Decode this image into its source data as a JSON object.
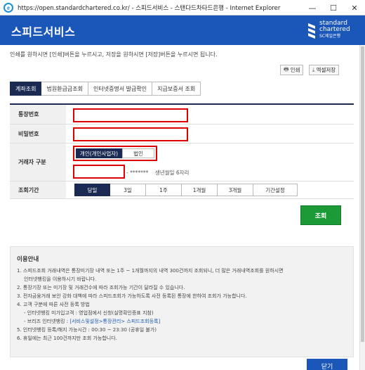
{
  "window": {
    "title": "https://open.standardchartered.co.kr/ - 스피드서비스 - 스탠다드차타드은행 - Internet Explorer",
    "icon": "ie-icon",
    "controls": [
      "—",
      "☐",
      "✕"
    ]
  },
  "header": {
    "title": "스피드서비스",
    "logo": {
      "line1": "standard",
      "line2": "chartered",
      "line3": "SC제일은행"
    }
  },
  "intro_text": "인쇄를 원하시면 [인쇄]버튼을 누르시고, 저장을 원하시면 [저장]버튼을 누르시면 됩니다.",
  "toolbar": {
    "print_label": "인쇄",
    "excel_label": "엑셀저장"
  },
  "tabs": [
    {
      "label": "계좌조회",
      "active": true
    },
    {
      "label": "법원환급금조회",
      "active": false
    },
    {
      "label": "인터넷증명서 발급확인",
      "active": false
    },
    {
      "label": "지급보증서 조회",
      "active": false
    }
  ],
  "form": {
    "account_label": "통장번호",
    "account_value": "",
    "password_label": "비밀번호",
    "password_value": "",
    "customer_type_label": "거래자 구분",
    "customer_types": [
      "개인(개인사업자)",
      "법인"
    ],
    "customer_type_selected": "개인(개인사업자)",
    "birth_value": "",
    "birth_mask": "- *******",
    "birth_hint": "생년월일 6자리",
    "period_label": "조회기간",
    "periods": [
      "당일",
      "3일",
      "1주",
      "1개월",
      "3개월",
      "기간설정"
    ],
    "period_selected": "당일",
    "search_label": "조회"
  },
  "notice": {
    "title": "이용안내",
    "items": [
      "1. 스피드조회 거래내역은 통장미기장 내역 또는 1주 ~ 1개월까지의 내역 300건까지 조회되니, 더 많은 거래내역조회를 원하시면",
      "인터넷뱅킹을 이용하시기 바랍니다.",
      "2. 통장기장 또는 미기장 및 거래건수에 따라 조회가능 기간이 달라질 수 있습니다.",
      "3. 전자금융거래 보안 강화 대책에 따라 스피드조회가 가능하도록 사전 등록된 통장에 한하여 조회가 가능합니다.",
      "4. 고객 구분에 따른 사전 등록 방법",
      "- 인터넷뱅킹 미가입고객 : 영업점에서 신청(실명확인증표 지참)",
      "- 브리즈 인터넷뱅킹 : ",
      "5. 인터넷뱅킹 등록/해지 가능시간 : 00:30 ~ 23:30 (공휴일 불가)",
      "6. 휴일에는 최근 100건까지만 조회 가능합니다."
    ],
    "link_text": "[서비스및설정>통장관리> 스피드조회등록]"
  },
  "close_label": "닫기"
}
